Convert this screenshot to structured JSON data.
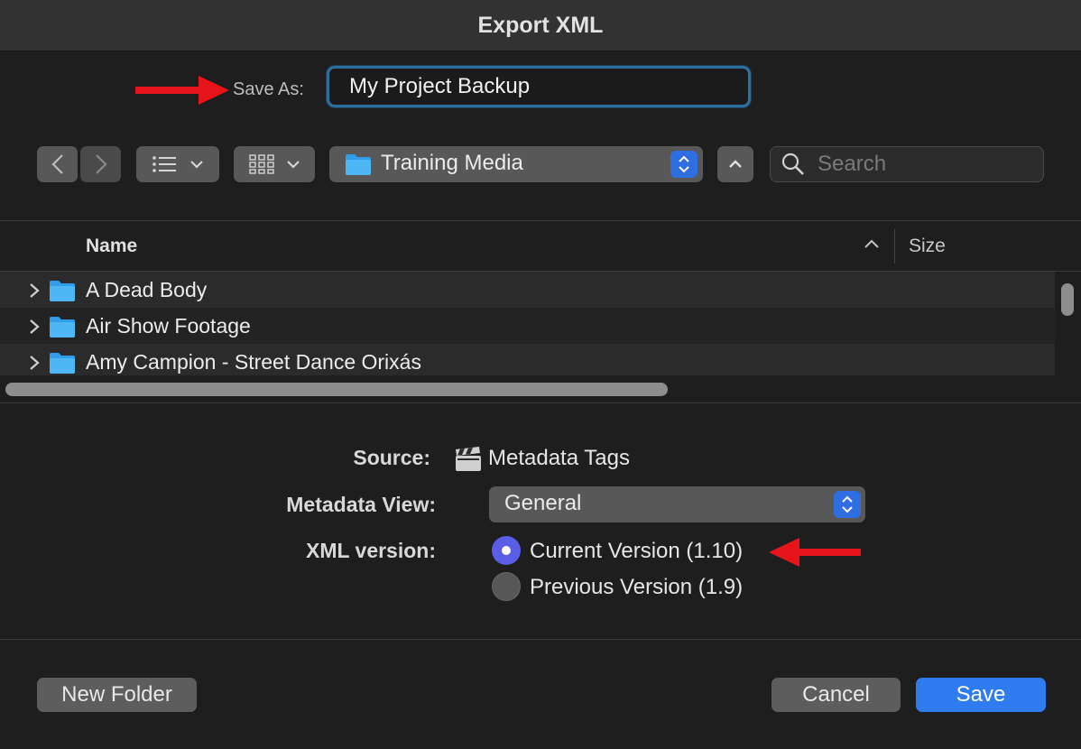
{
  "window": {
    "title": "Export XML"
  },
  "save_as": {
    "label": "Save As:",
    "value": "My Project Backup"
  },
  "toolbar": {
    "back_icon": "chevron-left-icon",
    "forward_icon": "chevron-right-icon",
    "list_view_icon": "list-icon",
    "grid_view_icon": "grid-icon",
    "location": "Training Media",
    "search_placeholder": "Search"
  },
  "file_list": {
    "columns": {
      "name": "Name",
      "size": "Size"
    },
    "rows": [
      {
        "name": "A Dead Body"
      },
      {
        "name": "Air Show Footage"
      },
      {
        "name": "Amy Campion - Street Dance Orixás"
      }
    ]
  },
  "options": {
    "source_label": "Source:",
    "source_value": "Metadata Tags",
    "metadata_view_label": "Metadata View:",
    "metadata_view_value": "General",
    "xml_version_label": "XML version:",
    "xml_versions": [
      {
        "label": "Current Version (1.10)",
        "selected": true
      },
      {
        "label": "Previous Version (1.9)",
        "selected": false
      }
    ]
  },
  "buttons": {
    "new_folder": "New Folder",
    "cancel": "Cancel",
    "save": "Save"
  },
  "colors": {
    "accent": "#2f7cf0",
    "annotation_arrow": "#e8141b",
    "radio_selected": "#5a5ee6"
  }
}
